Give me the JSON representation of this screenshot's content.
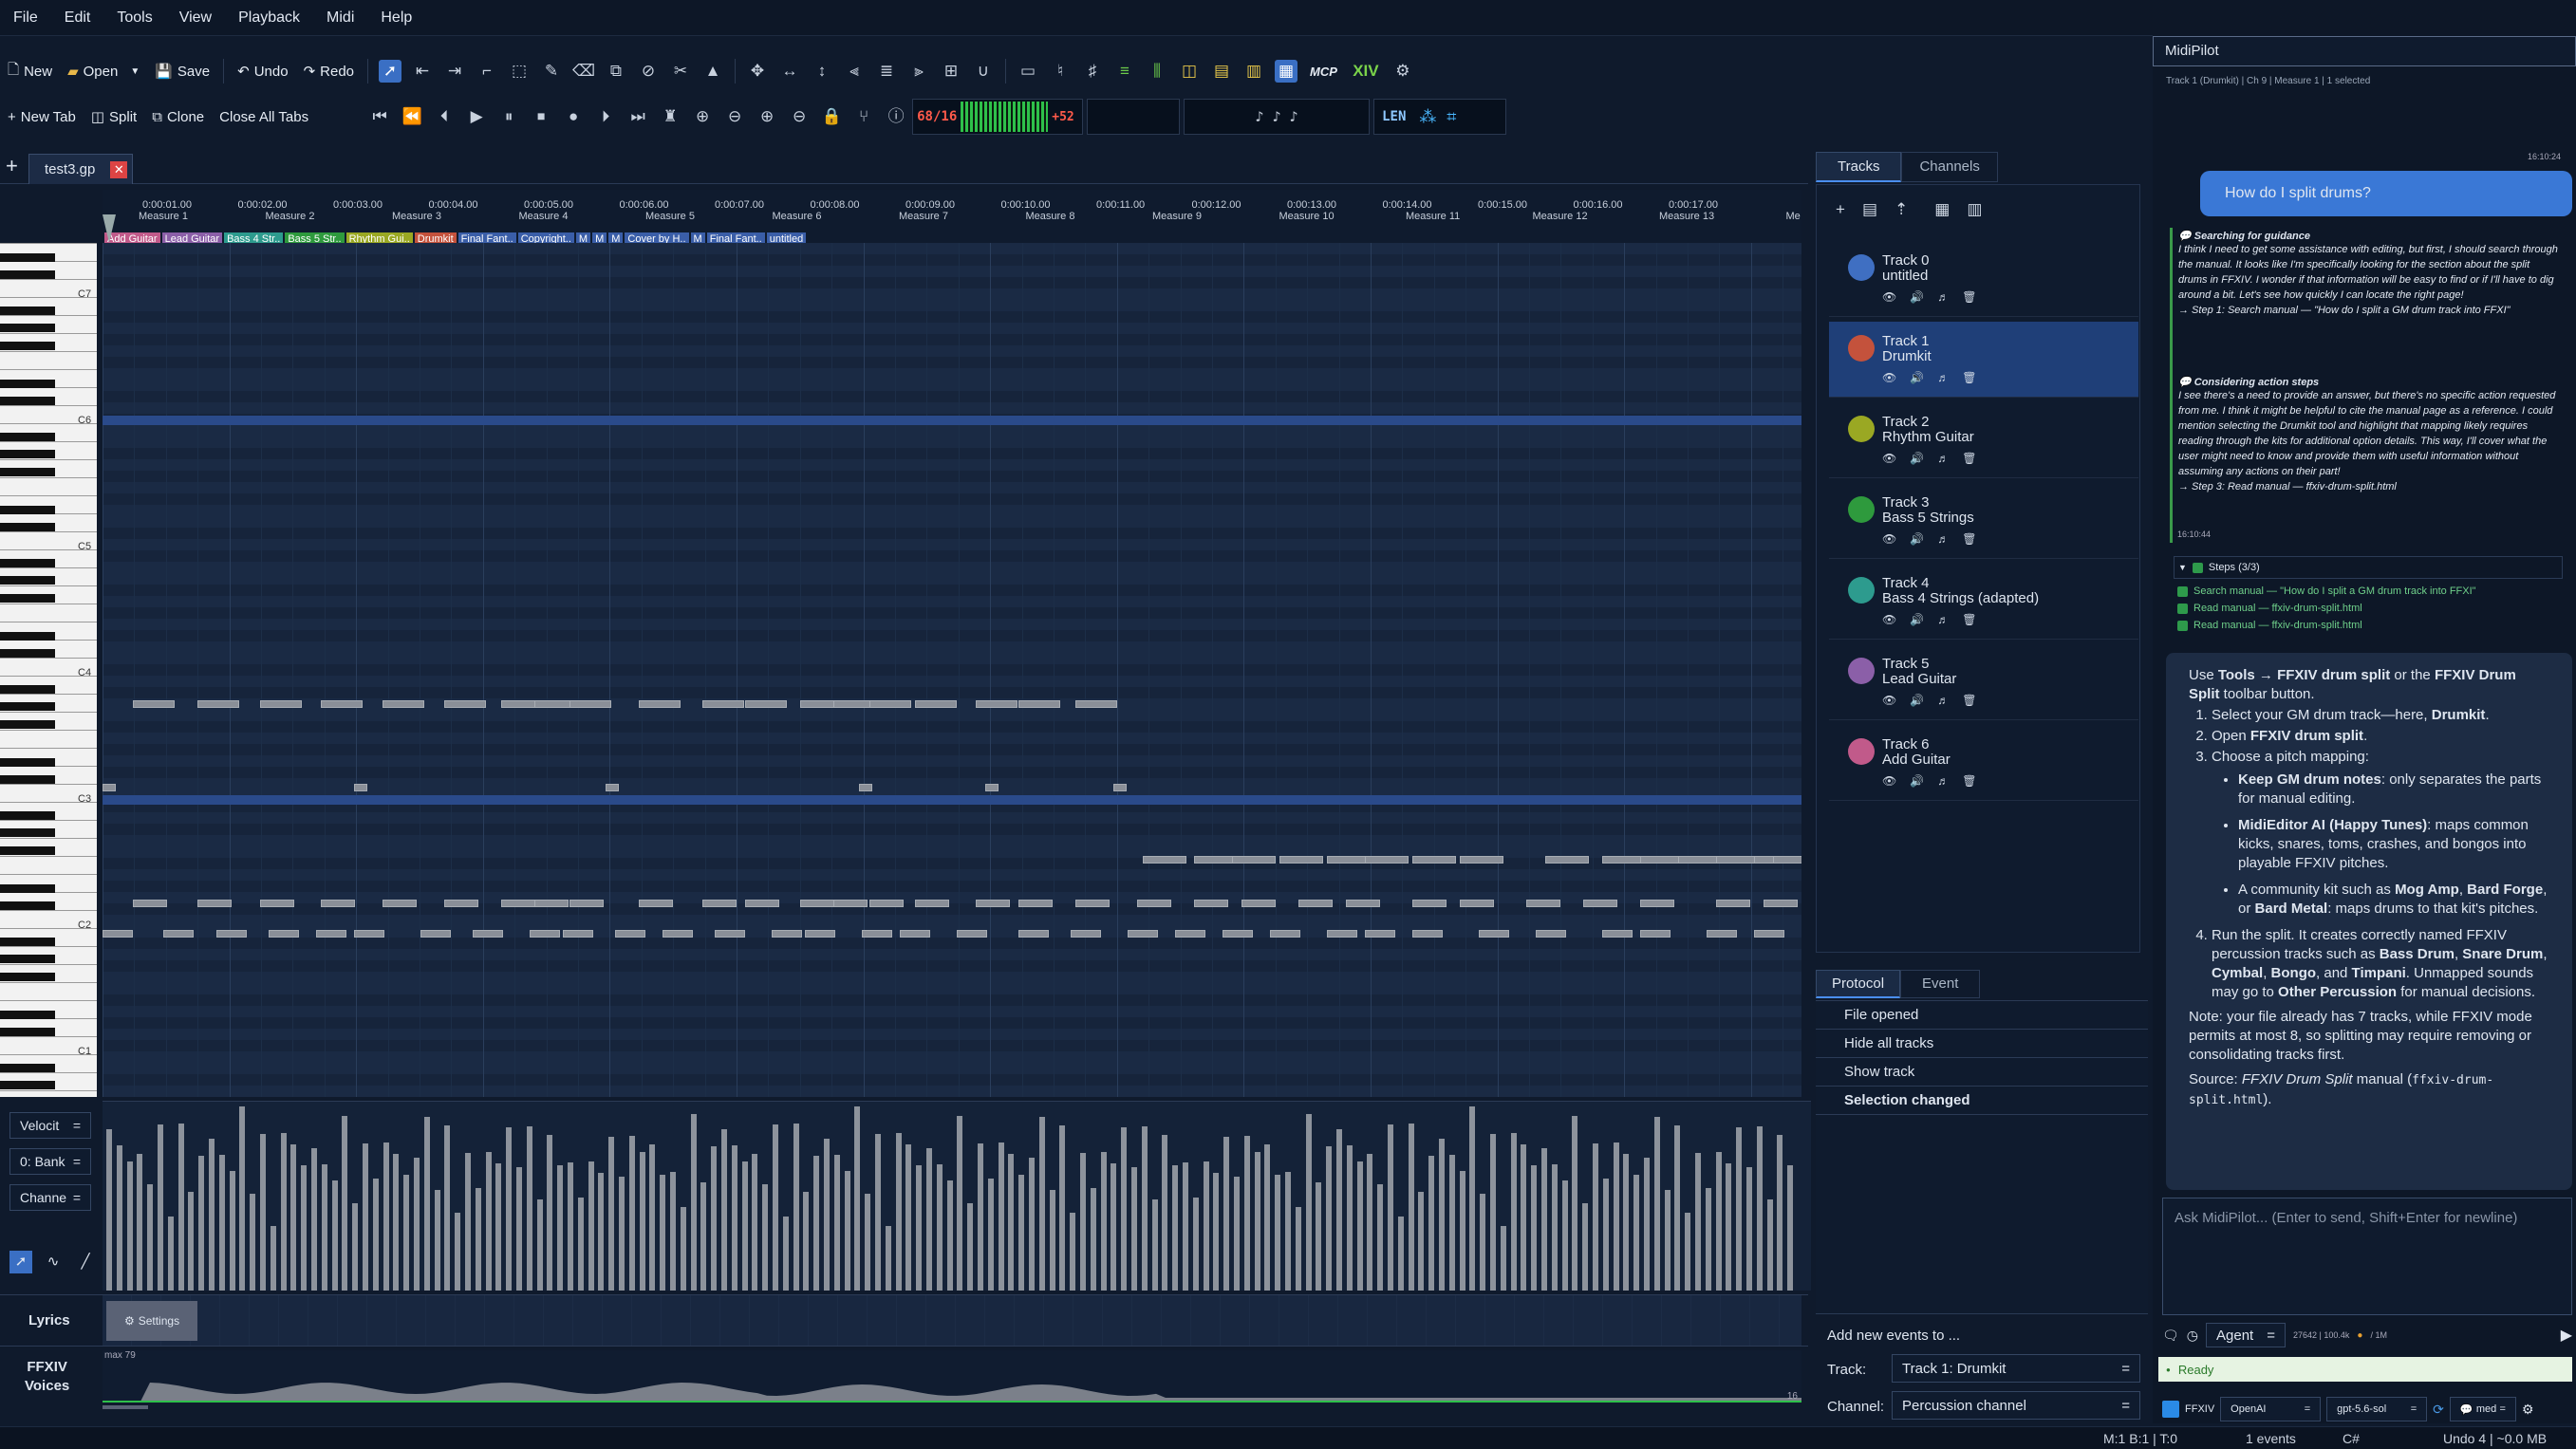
{
  "menu": [
    "File",
    "Edit",
    "Tools",
    "View",
    "Playback",
    "Midi",
    "Help"
  ],
  "toolbar": {
    "new": "New",
    "open": "Open",
    "save": "Save",
    "undo": "Undo",
    "redo": "Redo",
    "new_tab": "New Tab",
    "split": "Split",
    "clone": "Clone",
    "close_all": "Close All Tabs",
    "mcp": "MCP",
    "measure": "68/16",
    "offset": "+52",
    "len": "LEN"
  },
  "file_tab": "test3.gp",
  "ruler": {
    "times": [
      "0:00:01.00",
      "0:00:02.00",
      "0:00:03.00",
      "0:00:04.00",
      "0:00:05.00",
      "0:00:06.00",
      "0:00:07.00",
      "0:00:08.00",
      "0:00:09.00",
      "0:00:10.00",
      "0:00:11.00",
      "0:00:12.00",
      "0:00:13.00",
      "0:00:14.00",
      "0:00:15.00",
      "0:00:16.00",
      "0:00:17.00"
    ],
    "measures": [
      "Measure 1",
      "Measure 2",
      "Measure 3",
      "Measure 4",
      "Measure 5",
      "Measure 6",
      "Measure 7",
      "Measure 8",
      "Measure 9",
      "Measure 10",
      "Measure 11",
      "Measure 12",
      "Measure 13",
      "Me"
    ],
    "markers": [
      {
        "label": "Add Guitar",
        "color": "#c15a8a"
      },
      {
        "label": "Lead Guitar",
        "color": "#8b5fa8"
      },
      {
        "label": "Bass 4 Str..",
        "color": "#2d9b8e"
      },
      {
        "label": "Bass 5 Str..",
        "color": "#2e9a3d"
      },
      {
        "label": "Rhythm Gui..",
        "color": "#9aa823"
      },
      {
        "label": "Drumkit",
        "color": "#c4523c"
      },
      {
        "label": "Final Fant..",
        "color": "#3a5ea8"
      },
      {
        "label": "Copyright..",
        "color": "#3a5ea8"
      },
      {
        "label": "M",
        "color": "#3a5ea8"
      },
      {
        "label": "M",
        "color": "#3a5ea8"
      },
      {
        "label": "M",
        "color": "#3a5ea8"
      },
      {
        "label": "Cover by H..",
        "color": "#3a5ea8"
      },
      {
        "label": "M",
        "color": "#3a5ea8"
      },
      {
        "label": "Final Fant..",
        "color": "#3a5ea8"
      },
      {
        "label": "untitled",
        "color": "#3a5ea8"
      }
    ]
  },
  "keys": [
    "C7",
    "C6",
    "C5",
    "C4",
    "C3",
    "C2",
    "C1"
  ],
  "left_controls": {
    "velocity": "Velocit",
    "bank": "0: Bank",
    "channel": "Channe"
  },
  "lyrics": {
    "label": "Lyrics",
    "settings": "Settings"
  },
  "ffxiv_voices": {
    "label": "FFXIV\nVoices",
    "top": "max 79",
    "bottom": "16"
  },
  "tracks_panel": {
    "tab_tracks": "Tracks",
    "tab_channels": "Channels",
    "tracks": [
      {
        "name": "Track 0",
        "sub": "untitled",
        "color": "#3f6fc2"
      },
      {
        "name": "Track 1",
        "sub": "Drumkit",
        "color": "#c4523c"
      },
      {
        "name": "Track 2",
        "sub": "Rhythm Guitar",
        "color": "#9aa823"
      },
      {
        "name": "Track 3",
        "sub": "Bass 5 Strings",
        "color": "#2e9a3d"
      },
      {
        "name": "Track 4",
        "sub": "Bass 4 Strings (adapted)",
        "color": "#2d9b8e"
      },
      {
        "name": "Track 5",
        "sub": "Lead Guitar",
        "color": "#8b5fa8"
      },
      {
        "name": "Track 6",
        "sub": "Add Guitar",
        "color": "#c15a8a"
      }
    ]
  },
  "protocol": {
    "tab_protocol": "Protocol",
    "tab_event": "Event",
    "items": [
      "File opened",
      "Hide all tracks",
      "Show track",
      "Selection changed"
    ]
  },
  "add_events": {
    "title": "Add new events to ...",
    "track_label": "Track:",
    "track_value": "Track 1: Drumkit",
    "channel_label": "Channel:",
    "channel_value": "Percussion channel"
  },
  "chat": {
    "title": "MidiPilot",
    "context": "Track 1 (Drumkit) | Ch 9 | Measure 1 | 1 selected",
    "time1": "16:10:24",
    "user_msg": "How do I split drums?",
    "think1_title": "Searching for guidance",
    "think1_body": "I think I need to get some assistance with editing, but first, I should search through the manual. It looks like I'm specifically looking for the section about the split drums in FFXIV. I wonder if that information will be easy to find or if I'll have to dig around a bit. Let's see how quickly I can locate the right page!",
    "think1_step": "→ Step 1: Search manual — \"How do I split a GM drum track into FFXI\"",
    "think2_title": "Considering action steps",
    "think2_body": "I see there's a need to provide an answer, but there's no specific action requested from me. I think it might be helpful to cite the manual page as a reference. I could mention selecting the Drumkit tool and highlight that mapping likely requires reading through the kits for additional option details. This way, I'll cover what the user might need to know and provide them with useful information without assuming any actions on their part!",
    "think2_step": "→ Step 3: Read manual — ffxiv-drum-split.html",
    "time2": "16:10:44",
    "steps_title": "Steps (3/3)",
    "steps": [
      "Search manual — \"How do I split a GM drum track into FFXI\"",
      "Read manual — ffxiv-drum-split.html",
      "Read manual — ffxiv-drum-split.html"
    ],
    "answer": {
      "intro_a": "Use ",
      "tools": "Tools → FFXIV drum split",
      "intro_b": " or the ",
      "btn": "FFXIV Drum Split",
      "intro_c": " toolbar button.",
      "s1a": "Select your GM drum track—here, ",
      "s1b": "Drumkit",
      ".": ".",
      "s2a": "Open ",
      "s2b": "FFXIV drum split",
      "s3": "Choose a pitch mapping:",
      "m1a": "Keep GM drum notes",
      ":": "",
      "m1b": ": only separates the parts for manual editing.",
      "m2a": "MidiEditor AI (Happy Tunes)",
      "m2b": ": maps common kicks, snares, toms, crashes, and bongos into playable FFXIV pitches.",
      "m3a": "A community kit such as ",
      "m3b": "Mog Amp",
      ", ": "",
      "m3c": "Bard Forge",
      "m3d": ", or ",
      "m3e": "Bard Metal",
      "m3f": ": maps drums to that kit's pitches.",
      "s4a": "Run the split. It creates correctly named FFXIV percussion tracks such as ",
      "s4b": "Bass Drum",
      "s4c": "Snare Drum",
      "s4d": "Cymbal",
      "s4e": "Bongo",
      "s4f": "Timpani",
      "s4g": ". Unmapped sounds may go to ",
      "s4h": "Other Percussion",
      "s4i": " for manual decisions.",
      "note": "Note: your file already has 7 tracks, while FFXIV mode permits at most 8, so splitting may require removing or consolidating tracks first.",
      "source_a": "Source: ",
      "source_b": "FFXIV Drum Split",
      "source_c": " manual (",
      "source_d": "ffxiv-drum-split.html",
      "source_e": ")."
    },
    "input_placeholder": "Ask MidiPilot... (Enter to send, Shift+Enter for newline)",
    "agent": "Agent",
    "tokens": "27642 | 100.4k",
    "tokens2": "/ 1M",
    "ready": "Ready",
    "ffxiv": "FFXIV",
    "provider": "OpenAI",
    "model": "gpt-5.6-sol",
    "effort": "med"
  },
  "status": {
    "pos": "M:1 B:1 | T:0",
    "events": "1 events",
    "key": "C#",
    "undo": "Undo 4 | ~0.0 MB"
  }
}
